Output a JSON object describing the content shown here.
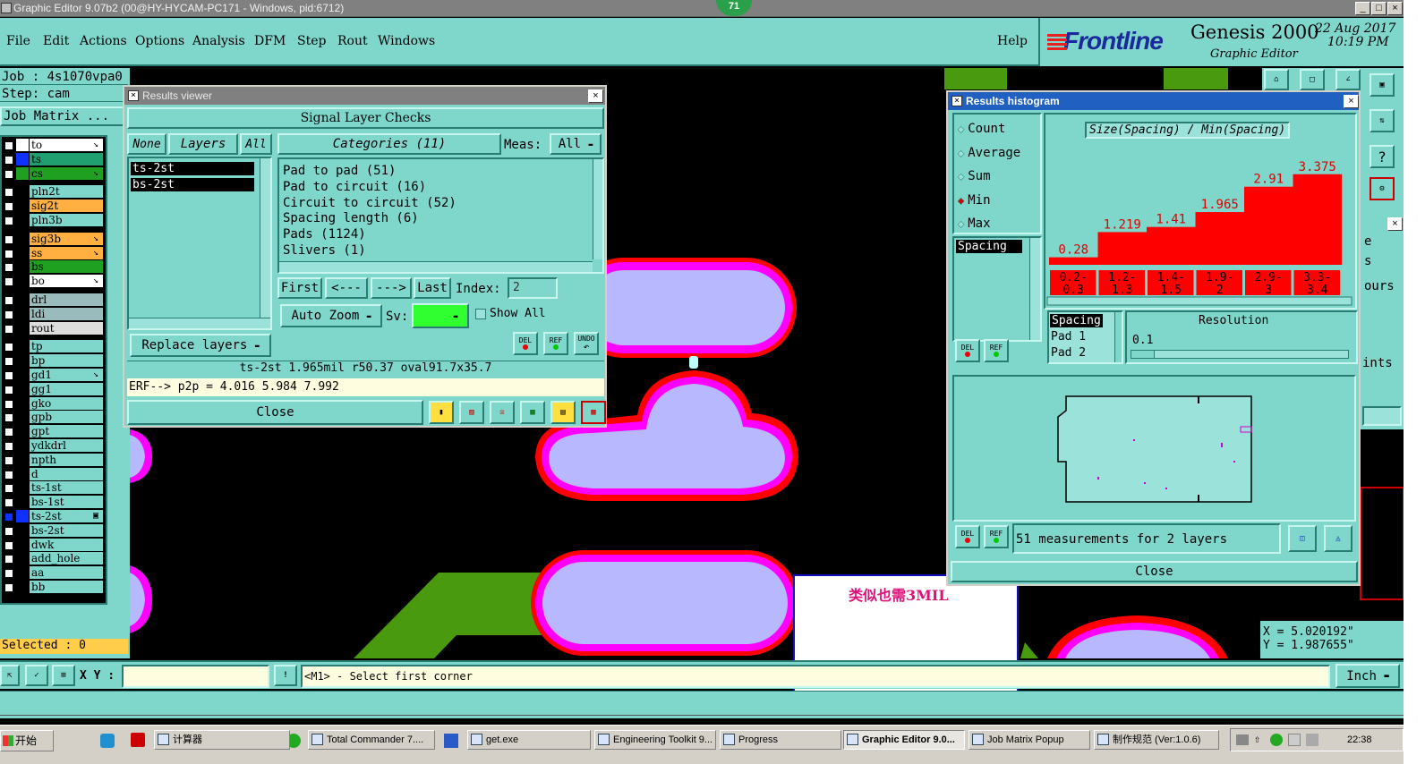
{
  "titlebar": {
    "title": "Graphic Editor 9.07b2 (00@HY-HYCAM-PC171 - Windows, pid:6712)",
    "badge": "71"
  },
  "menu": {
    "items": [
      "File",
      "Edit",
      "Actions",
      "Options",
      "Analysis",
      "DFM",
      "Step",
      "Rout",
      "Windows"
    ],
    "help": "Help"
  },
  "brand": {
    "logo": "Frontline",
    "product": "Genesis 2000",
    "subtitle": "Graphic Editor",
    "date": "22 Aug 2017",
    "time": "10:19 PM"
  },
  "job": {
    "job": "Job : 4s1070vpa0",
    "step": "Step: cam",
    "matrix": "Job Matrix ...",
    "selected": "Selected : 0"
  },
  "layers": [
    {
      "name": "to",
      "color": "#ffffff",
      "mark": "↘"
    },
    {
      "name": "ts",
      "color": "#1030ff",
      "mark": ""
    },
    {
      "name": "cs",
      "color": "#20a020",
      "mark": "↘"
    },
    {
      "name": "pln2t",
      "color": "",
      "mark": ""
    },
    {
      "name": "sig2t",
      "color": "",
      "mark": ""
    },
    {
      "name": "pln3b",
      "color": "",
      "mark": ""
    },
    {
      "name": "sig3b",
      "color": "",
      "mark": "↘"
    },
    {
      "name": "ss",
      "color": "",
      "mark": "↘"
    },
    {
      "name": "bs",
      "color": "",
      "mark": ""
    },
    {
      "name": "bo",
      "color": "",
      "mark": "↘"
    },
    {
      "name": "drl",
      "color": "",
      "mark": ""
    },
    {
      "name": "ldi",
      "color": "",
      "mark": ""
    },
    {
      "name": "rout",
      "color": "",
      "mark": ""
    },
    {
      "name": "tp",
      "color": "",
      "mark": ""
    },
    {
      "name": "bp",
      "color": "",
      "mark": ""
    },
    {
      "name": "gd1",
      "color": "",
      "mark": "↘"
    },
    {
      "name": "gg1",
      "color": "",
      "mark": ""
    },
    {
      "name": "gko",
      "color": "",
      "mark": ""
    },
    {
      "name": "gpb",
      "color": "",
      "mark": ""
    },
    {
      "name": "gpt",
      "color": "",
      "mark": ""
    },
    {
      "name": "ydkdrl",
      "color": "",
      "mark": ""
    },
    {
      "name": "npth",
      "color": "",
      "mark": ""
    },
    {
      "name": "d",
      "color": "",
      "mark": ""
    },
    {
      "name": "ts-1st",
      "color": "",
      "mark": ""
    },
    {
      "name": "bs-1st",
      "color": "",
      "mark": ""
    },
    {
      "name": "ts-2st",
      "color": "#1030ff",
      "mark": "▣"
    },
    {
      "name": "bs-2st",
      "color": "",
      "mark": ""
    },
    {
      "name": "dwk",
      "color": "",
      "mark": ""
    },
    {
      "name": "add_hole",
      "color": "",
      "mark": ""
    },
    {
      "name": "aa",
      "color": "",
      "mark": ""
    },
    {
      "name": "bb",
      "color": "",
      "mark": ""
    }
  ],
  "results_viewer": {
    "title": "Results viewer",
    "header": "Signal Layer Checks",
    "btn_none": "None",
    "btn_layers": "Layers",
    "btn_all": "All",
    "categories_label": "Categories (11)",
    "meas_label": "Meas:",
    "meas_value": "All",
    "layers": [
      "ts-2st",
      "bs-2st"
    ],
    "categories": [
      "Pad to pad (51)",
      "Pad to circuit (16)",
      "Circuit to circuit (52)",
      "Spacing length (6)",
      "Pads (1124)",
      "Slivers (1)"
    ],
    "nav": {
      "first": "First",
      "prev": "<---",
      "next": "--->",
      "last": "Last",
      "index_label": "Index:",
      "index_value": "2"
    },
    "auto_zoom": "Auto Zoom",
    "sv_label": "Sv:",
    "show_all": "Show All",
    "replace_layers": "Replace layers",
    "info": "ts-2st 1.965mil  r50.37  oval91.7x35.7",
    "erf": "ERF--> p2p = 4.016 5.984 7.992",
    "close": "Close",
    "del": "DEL",
    "ref": "REF",
    "undo": "UNDO"
  },
  "histogram": {
    "title": "Results histogram",
    "options": [
      "Count",
      "Average",
      "Sum",
      "Min",
      "Max"
    ],
    "selected_option": "Min",
    "chart_title": "Size(Spacing) / Min(Spacing)",
    "list_item": "Spacing",
    "table_header": "Spacing",
    "table_rows": [
      "Pad 1",
      "Pad 2"
    ],
    "resolution_label": "Resolution",
    "resolution_value": "0.1",
    "measurements": "51 measurements for 2 layers",
    "close": "Close",
    "del": "DEL",
    "ref": "REF"
  },
  "chart_data": {
    "type": "bar",
    "title": "Size(Spacing) / Min(Spacing)",
    "categories": [
      "0.2-0.3",
      "1.2-1.3",
      "1.4-1.5",
      "1.9-2",
      "2.9-3",
      "3.3-3.4"
    ],
    "values": [
      0.28,
      1.219,
      1.41,
      1.965,
      2.91,
      3.375
    ],
    "value_labels": [
      "0.28",
      "1.219",
      "1.41",
      "1.965",
      "2.91",
      "3.375"
    ],
    "bin_labels": [
      [
        "0.2-",
        "0.3"
      ],
      [
        "1.2-",
        "1.3"
      ],
      [
        "1.4-",
        "1.5"
      ],
      [
        "1.9-",
        "2"
      ],
      [
        "2.9-",
        "3"
      ],
      [
        "3.3-",
        "3.4"
      ]
    ],
    "color": "#ff0000",
    "ylim": [
      0,
      3.6
    ]
  },
  "right_panel": {
    "labels": [
      "e",
      "s",
      "ours",
      "ints"
    ]
  },
  "note": {
    "text": "类似也需3MIL"
  },
  "coords": {
    "x": "X = 5.020192\"",
    "y": "Y = 1.987655\""
  },
  "bottom": {
    "xy_label": "X Y :",
    "prompt": "<M1> - Select first corner",
    "units": "Inch"
  },
  "taskbar": {
    "start": "开始",
    "items": [
      "计算器",
      "Total Commander 7....",
      "get.exe",
      "Engineering Toolkit 9...",
      "Progress",
      "Graphic Editor 9.0...",
      "Job Matrix Popup",
      "制作规范 (Ver:1.0.6)"
    ],
    "clock": "22:38"
  }
}
